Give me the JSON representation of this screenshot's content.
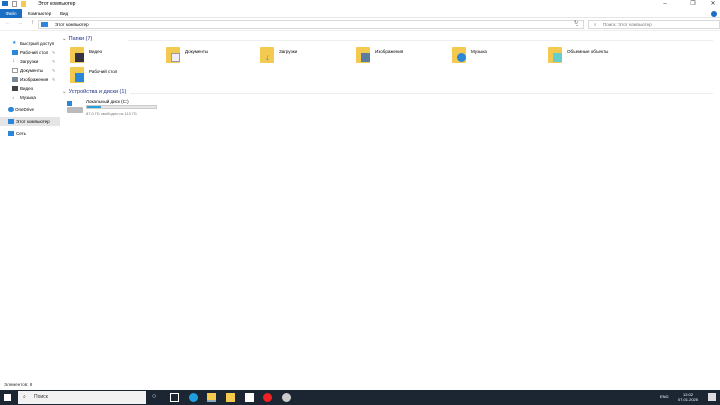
{
  "window": {
    "title": "Этот компьютер"
  },
  "ribbon": {
    "tabs": [
      "Файл",
      "Компьютер",
      "Вид"
    ]
  },
  "address": {
    "path": "Этот компьютер",
    "search_placeholder": "Поиск: Этот компьютер"
  },
  "sidebar": {
    "items": [
      {
        "label": "Быстрый доступ",
        "icon": "star-icon"
      },
      {
        "label": "Рабочий стол",
        "icon": "desktop-icon",
        "pinned": true
      },
      {
        "label": "Загрузки",
        "icon": "download-icon",
        "pinned": true
      },
      {
        "label": "Документы",
        "icon": "documents-icon",
        "pinned": true
      },
      {
        "label": "Изображения",
        "icon": "pictures-icon",
        "pinned": true
      },
      {
        "label": "Видео",
        "icon": "video-icon"
      },
      {
        "label": "Музыка",
        "icon": "music-icon"
      },
      {
        "label": "OneDrive",
        "icon": "cloud-icon"
      },
      {
        "label": "Этот компьютер",
        "icon": "computer-icon",
        "selected": true
      },
      {
        "label": "Сеть",
        "icon": "network-icon"
      }
    ]
  },
  "folders": {
    "header": "Папки (7)",
    "items": [
      "Видео",
      "Документы",
      "Загрузки",
      "Изображения",
      "Музыка",
      "Объемные объекты",
      "Рабочий стол"
    ]
  },
  "devices": {
    "header": "Устройства и диски (1)",
    "disk": {
      "name": "Локальный диск (C:)",
      "free_text": "87,0 ГБ свободно из 110 ГБ",
      "used_fraction": 0.21
    }
  },
  "status": {
    "text": "Элементов: 8"
  },
  "taskbar": {
    "search": "Поиск",
    "lang": "ENG",
    "time": "12:02",
    "date": "07.01.2025"
  },
  "colors": {
    "accent": "#1a6fc4",
    "disk_bar": "#26a0da",
    "taskbar": "#1c2633"
  }
}
